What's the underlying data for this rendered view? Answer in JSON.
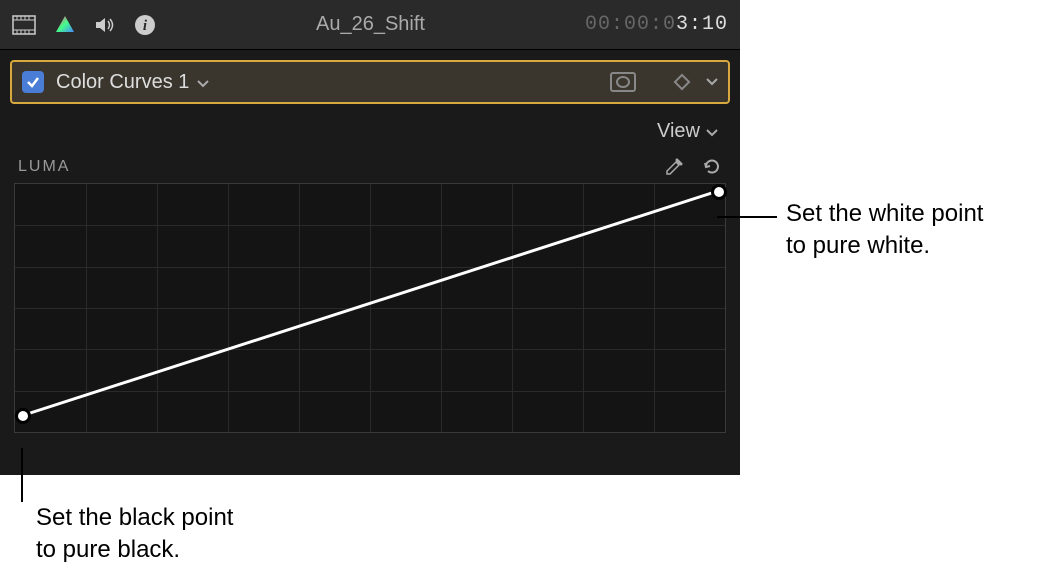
{
  "topbar": {
    "clip_name": "Au_26_Shift",
    "timecode_inactive": "00:00:0",
    "timecode_active": "3:10"
  },
  "effect": {
    "checkbox_checked": true,
    "name": "Color Curves 1"
  },
  "view": {
    "label": "View"
  },
  "curves": {
    "label": "LUMA"
  },
  "callouts": {
    "white_point": "Set the white point\nto pure white.",
    "black_point": "Set the black point\nto pure black."
  },
  "icons": {
    "video": "video-filmstrip-icon",
    "color": "color-prism-icon",
    "audio": "speaker-icon",
    "info": "info-icon",
    "mask": "mask-icon",
    "keyframe": "keyframe-diamond-icon",
    "dropdown": "chevron-down-icon",
    "eyedropper": "eyedropper-icon",
    "reset": "reset-icon"
  }
}
